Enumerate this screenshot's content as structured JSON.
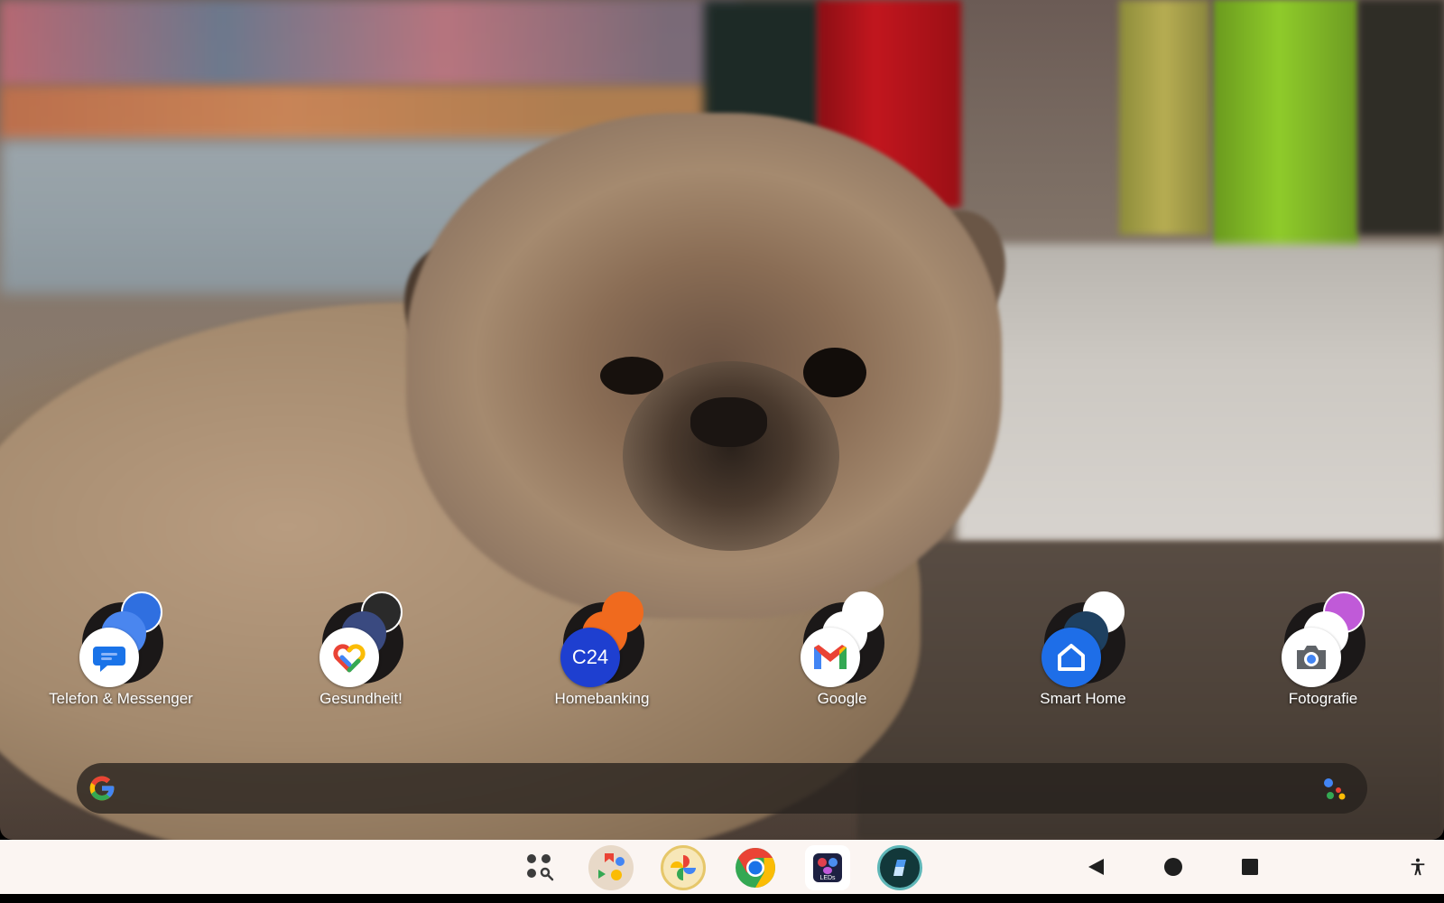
{
  "wallpaper": {
    "subject": "dog-photo"
  },
  "folders": [
    {
      "label": "Telefon & Messenger",
      "front_icon": "messages-icon",
      "colors": {
        "front": "#ffffff",
        "mid": "#4a86ef",
        "small": "#2f6fe0"
      }
    },
    {
      "label": "Gesundheit!",
      "front_icon": "google-fit-icon",
      "colors": {
        "front": "#ffffff",
        "mid": "#3a4a80",
        "small": "#2a2a2a"
      }
    },
    {
      "label": "Homebanking",
      "front_icon": "c24-bank-icon",
      "front_text": "C24",
      "colors": {
        "front": "#1e3fd0",
        "mid": "#f06a1e",
        "small": "#f06a1e"
      }
    },
    {
      "label": "Google",
      "front_icon": "gmail-icon",
      "colors": {
        "front": "#ffffff",
        "mid": "#ffffff",
        "small": "#ffffff"
      }
    },
    {
      "label": "Smart Home",
      "front_icon": "google-home-icon",
      "colors": {
        "front": "#1e6ee8",
        "mid": "#1e4060",
        "small": "#ffffff"
      }
    },
    {
      "label": "Fotografie",
      "front_icon": "camera-icon",
      "colors": {
        "front": "#ffffff",
        "mid": "#ffffff",
        "small": "#c05ad8"
      }
    }
  ],
  "searchbar": {
    "left_icon": "google-g-icon",
    "right_icon": "google-assistant-icon"
  },
  "taskbar": {
    "apps": [
      {
        "name": "app-drawer-icon"
      },
      {
        "name": "app-folder-icon"
      },
      {
        "name": "google-photos-icon"
      },
      {
        "name": "chrome-icon"
      },
      {
        "name": "led-app-icon",
        "text": "LEDs"
      },
      {
        "name": "shortcut-app-icon"
      }
    ],
    "nav": [
      "back-icon",
      "home-icon",
      "recents-icon"
    ],
    "accessibility": "accessibility-icon"
  },
  "colors": {
    "taskbar_bg": "#fbf5f2",
    "search_bg": "#26211e",
    "label": "#ffffff",
    "google_blue": "#4285f4",
    "google_red": "#ea4335",
    "google_yellow": "#fbbc05",
    "google_green": "#34a853"
  }
}
